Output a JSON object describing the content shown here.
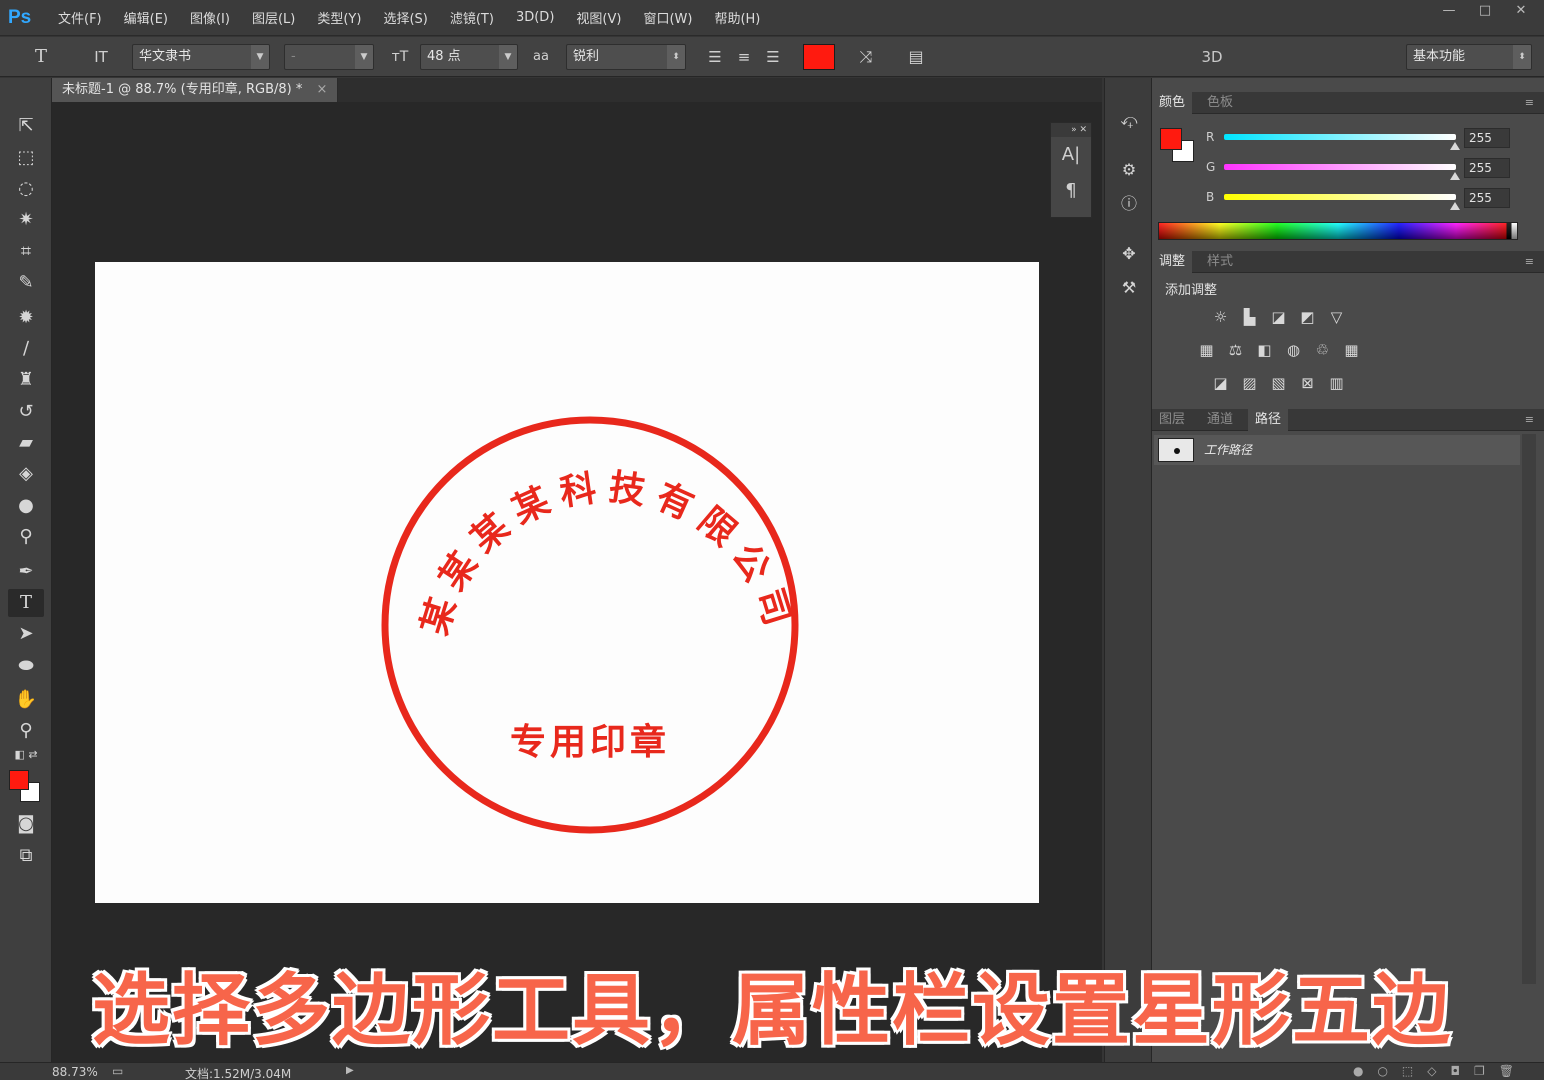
{
  "app": {
    "logo": "Ps"
  },
  "menu": [
    "文件(F)",
    "编辑(E)",
    "图像(I)",
    "图层(L)",
    "类型(Y)",
    "选择(S)",
    "滤镜(T)",
    "3D(D)",
    "视图(V)",
    "窗口(W)",
    "帮助(H)"
  ],
  "window": {
    "minimize": "—",
    "restore": "□",
    "close": "✕"
  },
  "options": {
    "tool_icon": "T",
    "orient_icon": "IT",
    "font_family": "华文隶书",
    "font_style": "-",
    "size_icon": "тT",
    "font_size": "48 点",
    "aa_icon": "aa",
    "antialias": "锐利",
    "text_color": "#ff1a0f",
    "view_3d": "3D",
    "workspace": "基本功能"
  },
  "document": {
    "tab_title": "未标题-1 @ 88.7% (专用印章, RGB/8) *",
    "close": "×",
    "stamp": {
      "color": "#e8281c",
      "arc_text": "某某某某科技有限公司",
      "center_text": "专用印章"
    }
  },
  "tools": [
    "move-tool",
    "marquee-tool",
    "lasso-tool",
    "magic-wand-tool",
    "crop-tool",
    "eyedropper-tool",
    "healing-tool",
    "brush-tool",
    "clone-stamp-tool",
    "history-brush-tool",
    "eraser-tool",
    "paint-bucket-tool",
    "blur-tool",
    "dodge-tool",
    "pen-tool",
    "type-tool",
    "path-selection-tool",
    "ellipse-tool",
    "hand-tool",
    "zoom-tool"
  ],
  "colors": {
    "foreground": "#ff1a0f",
    "background": "#ffffff"
  },
  "color_panel": {
    "tabs": [
      "颜色",
      "色板"
    ],
    "channels": [
      {
        "label": "R",
        "value": "255",
        "gradient": "#00e5ff"
      },
      {
        "label": "G",
        "value": "255",
        "gradient": "#ff33ff"
      },
      {
        "label": "B",
        "value": "255",
        "gradient": "#ffff00"
      }
    ]
  },
  "adjust_panel": {
    "tabs": [
      "调整",
      "样式"
    ],
    "heading": "添加调整"
  },
  "layers_panel": {
    "tabs": [
      "图层",
      "通道",
      "路径"
    ],
    "path_name": "工作路径"
  },
  "status": {
    "zoom": "88.73%",
    "doc_info": "文档:1.52M/3.04M"
  },
  "subtitle": "选择多边形工具，属性栏设置星形五边"
}
